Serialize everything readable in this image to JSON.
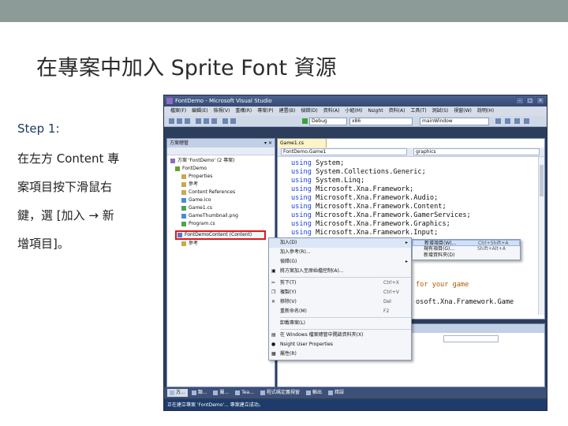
{
  "slide": {
    "title": "在專案中加入 Sprite Font 資源",
    "step": "Step 1:",
    "body_lines": [
      "在左方 Content 專",
      "案項目按下滑鼠右",
      "鍵，選 [加入 → 新",
      "增項目]。"
    ]
  },
  "vs": {
    "window_title": "FontDemo - Microsoft Visual Studio",
    "window_buttons": [
      "–",
      "□",
      "×"
    ],
    "menu": [
      "檔案(F)",
      "編輯(E)",
      "檢視(V)",
      "重構(R)",
      "專案(P)",
      "建置(B)",
      "偵錯(D)",
      "資料(A)",
      "小組(M)",
      "Nsight",
      "資料(A)",
      "工具(T)",
      "測試(S)",
      "視窗(W)",
      "說明(H)"
    ],
    "toolbar": {
      "config": "Debug",
      "platform": "x86",
      "find": "mainWindow"
    },
    "solution_explorer": {
      "title": "方案總管",
      "pin": "▾ ✕",
      "items": [
        {
          "label": "方案 'FontDemo' (2 專案)",
          "icon_color": "#8e6bc4"
        },
        {
          "label": "FontDemo",
          "icon_color": "#6b9c3b"
        },
        {
          "label": "Properties",
          "icon_color": "#c9a84f"
        },
        {
          "label": "參考",
          "icon_color": "#c9a84f"
        },
        {
          "label": "Content References",
          "icon_color": "#c9a84f"
        },
        {
          "label": "Game.ico",
          "icon_color": "#4b8ad6"
        },
        {
          "label": "Game1.cs",
          "icon_color": "#4fa24f"
        },
        {
          "label": "GameThumbnail.png",
          "icon_color": "#4b8ad6"
        },
        {
          "label": "Program.cs",
          "icon_color": "#4fa24f"
        }
      ],
      "selected_item": "FontDemoContent (Content)",
      "after_selected": "參考"
    },
    "editor": {
      "tab": "Game1.cs",
      "left_combo": "FontDemo.Game1",
      "right_combo": "graphics",
      "using_keyword": "using",
      "usings": [
        "System;",
        "System.Collections.Generic;",
        "System.Linq;",
        "Microsoft.Xna.Framework;",
        "Microsoft.Xna.Framework.Audio;",
        "Microsoft.Xna.Framework.Content;",
        "Microsoft.Xna.Framework.GamerServices;",
        "Microsoft.Xna.Framework.Graphics;",
        "Microsoft.Xna.Framework.Input;"
      ],
      "behind_line1": "for your game",
      "behind_line2": "osoft.Xna.Framework.Game"
    },
    "context_menu": [
      {
        "label": "加入(D)",
        "icon": "",
        "shortcut": "",
        "arrow": "▸",
        "highlight": true
      },
      {
        "label": "加入參考(R)...",
        "icon": "",
        "shortcut": ""
      },
      {
        "label": "偵錯(G)",
        "icon": "",
        "shortcut": "",
        "arrow": "▸"
      },
      {
        "label": "將方案加入至原始檔控制(A)...",
        "icon": "▣",
        "shortcut": ""
      },
      {
        "sep": true
      },
      {
        "label": "剪下(T)",
        "icon": "✂",
        "shortcut": "Ctrl+X"
      },
      {
        "label": "複製(Y)",
        "icon": "❐",
        "shortcut": "Ctrl+V"
      },
      {
        "label": "移除(V)",
        "icon": "✕",
        "shortcut": "Del"
      },
      {
        "label": "重新命名(M)",
        "icon": "",
        "shortcut": "F2"
      },
      {
        "sep": true
      },
      {
        "label": "卸載專案(L)",
        "icon": "",
        "shortcut": ""
      },
      {
        "sep": true
      },
      {
        "label": "在 Windows 檔案總管中開啟資料夾(X)",
        "icon": "▤",
        "shortcut": ""
      },
      {
        "label": "Nsight User Properties",
        "icon": "●",
        "shortcut": ""
      },
      {
        "label": "屬性(R)",
        "icon": "▦",
        "shortcut": ""
      }
    ],
    "submenu": [
      {
        "label": "新增項目(W)...",
        "shortcut": "Ctrl+Shift+A",
        "highlight": true
      },
      {
        "label": "現有項目(G)...",
        "shortcut": "Shift+Alt+A"
      },
      {
        "label": "新增資料夾(D)",
        "shortcut": ""
      }
    ],
    "bottom_tabs": [
      {
        "label": "方...",
        "active": true
      },
      {
        "label": "類...",
        "active": false
      },
      {
        "label": "屬...",
        "active": false
      },
      {
        "label": "Tea...",
        "active": false
      },
      {
        "label": "程式碼定義視窗",
        "active": false
      },
      {
        "label": "輸出",
        "active": false
      },
      {
        "label": "錯誤",
        "active": false
      }
    ],
    "status": "正在建立專案 'FontDemo'... 專案建立成功。"
  }
}
